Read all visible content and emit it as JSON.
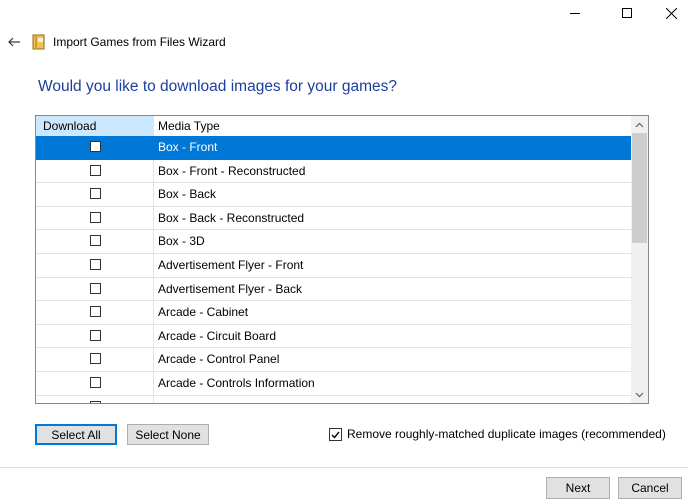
{
  "window": {
    "title": "Import Games from Files Wizard",
    "controls": {
      "minimize_icon": "minimize-icon",
      "maximize_icon": "maximize-icon",
      "close_icon": "close-icon"
    }
  },
  "heading": "Would you like to download images for your games?",
  "grid": {
    "columns": [
      "Download",
      "Media Type"
    ],
    "rows": [
      {
        "download": false,
        "media_type": "Box - Front",
        "selected": true
      },
      {
        "download": false,
        "media_type": "Box - Front - Reconstructed"
      },
      {
        "download": false,
        "media_type": "Box - Back"
      },
      {
        "download": false,
        "media_type": "Box - Back - Reconstructed"
      },
      {
        "download": false,
        "media_type": "Box - 3D"
      },
      {
        "download": false,
        "media_type": "Advertisement Flyer - Front"
      },
      {
        "download": false,
        "media_type": "Advertisement Flyer - Back"
      },
      {
        "download": false,
        "media_type": "Arcade - Cabinet"
      },
      {
        "download": false,
        "media_type": "Arcade - Circuit Board"
      },
      {
        "download": false,
        "media_type": "Arcade - Control Panel"
      },
      {
        "download": false,
        "media_type": "Arcade - Controls Information"
      }
    ]
  },
  "buttons": {
    "select_all": "Select All",
    "select_none": "Select None",
    "next": "Next",
    "cancel": "Cancel"
  },
  "options": {
    "remove_duplicates": {
      "label": "Remove roughly-matched duplicate images (recommended)",
      "checked": true
    }
  },
  "colors": {
    "accent": "#0078d7",
    "heading": "#1c3f9e",
    "header_highlight": "#cce8ff"
  }
}
